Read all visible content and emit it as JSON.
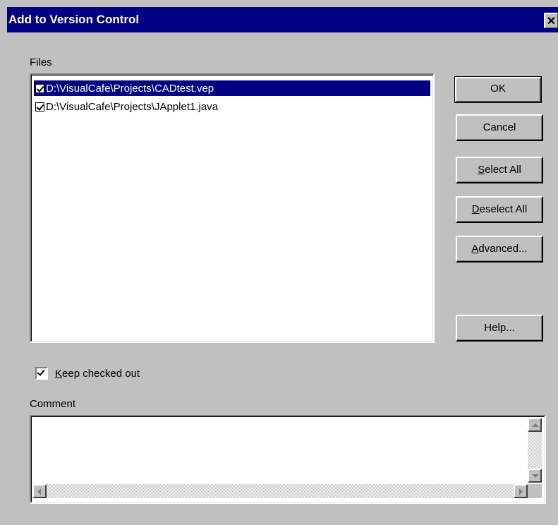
{
  "window": {
    "title": "Add to Version Control",
    "close_glyph": "✕"
  },
  "files": {
    "label": "Files",
    "items": [
      {
        "path": "D:\\VisualCafe\\Projects\\CADtest.vep",
        "checked": true,
        "selected": true
      },
      {
        "path": "D:\\VisualCafe\\Projects\\JApplet1.java",
        "checked": true,
        "selected": false
      }
    ]
  },
  "buttons": {
    "ok": "OK",
    "cancel": "Cancel",
    "select_all_key": "S",
    "select_all_rest": "elect All",
    "deselect_all_key": "D",
    "deselect_all_rest": "eselect All",
    "advanced_key": "A",
    "advanced_rest": "dvanced...",
    "help": "Help..."
  },
  "keep_checked_out": {
    "key": "K",
    "rest": "eep checked out",
    "checked": true
  },
  "comment": {
    "label": "Comment",
    "value": ""
  },
  "colors": {
    "title_bar": "#000080",
    "face": "#c0c0c0",
    "selection": "#000080"
  }
}
